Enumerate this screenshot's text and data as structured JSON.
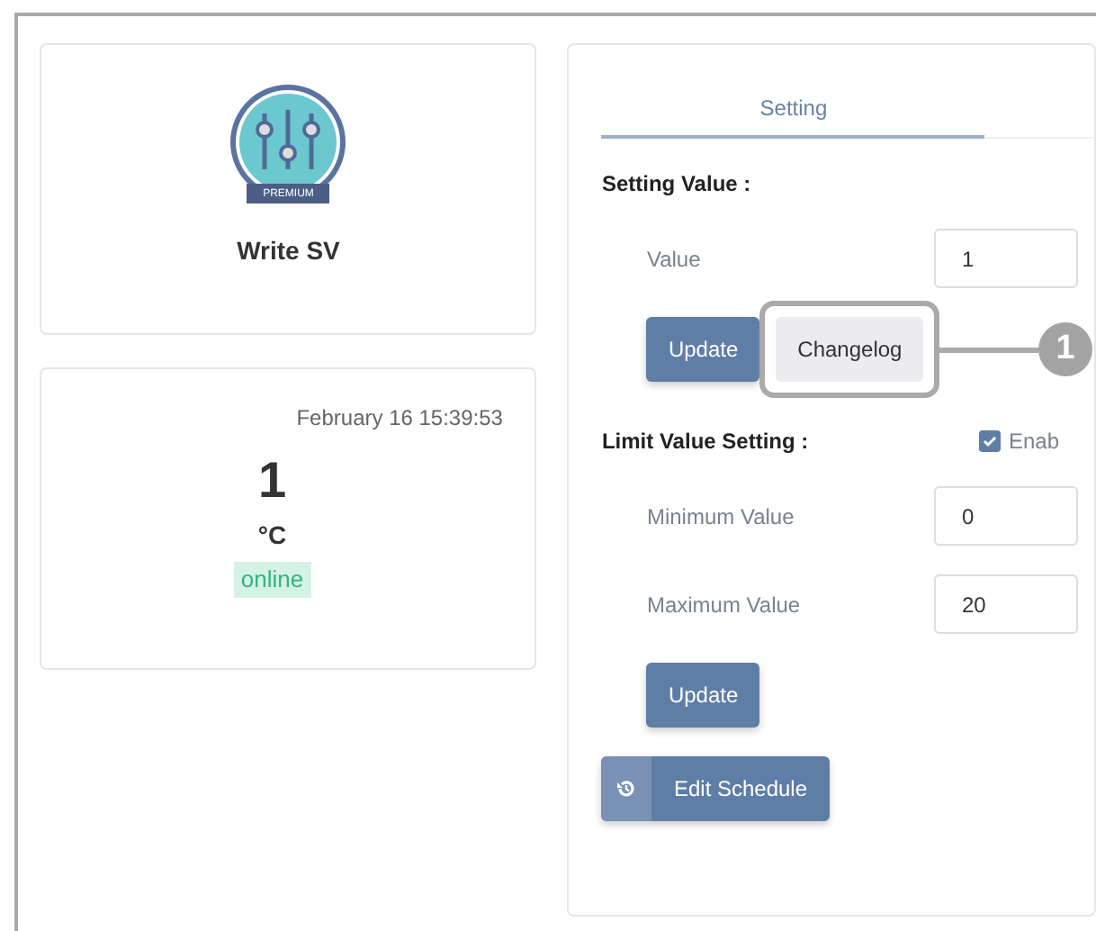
{
  "device_card": {
    "title": "Write SV",
    "badge": "PREMIUM"
  },
  "status_card": {
    "timestamp": "February 16 15:39:53",
    "value": "1",
    "unit": "°C",
    "status": "online",
    "online": true
  },
  "tabs": [
    {
      "label": "Setting",
      "selected": true
    }
  ],
  "setting_value": {
    "heading": "Setting Value :",
    "fields": [
      {
        "label": "Value",
        "value": "1"
      }
    ],
    "buttons": [
      {
        "label": "Update",
        "kind": "primary"
      },
      {
        "label": "Changelog",
        "kind": "light"
      }
    ]
  },
  "limit_setting": {
    "heading": "Limit Value Setting :",
    "enable": {
      "label": "Enab",
      "checked": true
    },
    "fields": [
      {
        "label": "Minimum Value",
        "value": "0"
      },
      {
        "label": "Maximum Value",
        "value": "20"
      }
    ],
    "buttons": [
      {
        "label": "Update",
        "kind": "primary"
      }
    ]
  },
  "schedule_button": {
    "label": "Edit Schedule"
  },
  "callout": {
    "number": "1"
  }
}
